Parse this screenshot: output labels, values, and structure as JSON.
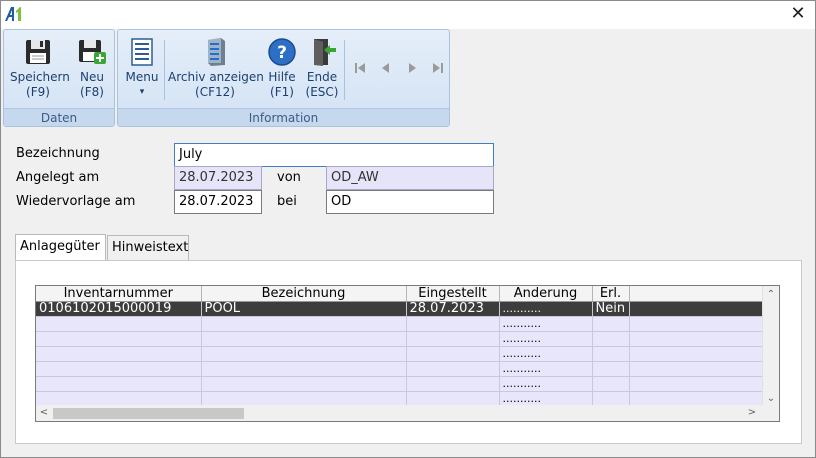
{
  "window": {
    "logo_text": "A1",
    "close_glyph": "✕"
  },
  "ribbon": {
    "groups": [
      {
        "title": "Daten"
      },
      {
        "title": "Information"
      }
    ],
    "buttons": {
      "save": {
        "label1": "Speichern",
        "label2": "(F9)",
        "icon": "floppy-disk-icon"
      },
      "new": {
        "label1": "Neu",
        "label2": "(F8)",
        "icon": "floppy-disk-plus-icon"
      },
      "menu": {
        "label1": "Menu",
        "label2": "▾",
        "icon": "menu-list-icon"
      },
      "archive": {
        "label1": "Archiv anzeigen",
        "label2": "(CF12)",
        "icon": "archive-server-icon"
      },
      "help": {
        "label1": "Hilfe",
        "label2": "(F1)",
        "icon": "help-question-icon"
      },
      "exit": {
        "label1": "Ende",
        "label2": "(ESC)",
        "icon": "exit-door-icon"
      }
    },
    "nav": {
      "first": "first-record-icon",
      "prev": "previous-record-icon",
      "next": "next-record-icon",
      "last": "last-record-icon"
    }
  },
  "form": {
    "bezeichnung_label": "Bezeichnung",
    "bezeichnung_value": "July",
    "angelegt_label": "Angelegt am",
    "angelegt_value": "28.07.2023",
    "von_label": "von",
    "von_value": "OD_AW",
    "wiedervorlage_label": "Wiedervorlage am",
    "wiedervorlage_value": "28.07.2023",
    "bei_label": "bei",
    "bei_value": "OD"
  },
  "tabs": [
    {
      "label": "Anlagegüter"
    },
    {
      "label": "Hinweistext"
    }
  ],
  "grid": {
    "columns": [
      "Inventarnummer",
      "Bezeichnung",
      "Eingestellt",
      "Änderung",
      "Erl.",
      ""
    ],
    "rows": [
      [
        "0106102015000019",
        "POOL",
        "28.07.2023",
        "...........",
        "Nein",
        ""
      ],
      [
        "",
        "",
        "",
        "...........",
        "",
        ""
      ],
      [
        "",
        "",
        "",
        "...........",
        "",
        ""
      ],
      [
        "",
        "",
        "",
        "...........",
        "",
        ""
      ],
      [
        "",
        "",
        "",
        "...........",
        "",
        ""
      ],
      [
        "",
        "",
        "",
        "...........",
        "",
        ""
      ],
      [
        "",
        "",
        "",
        "...........",
        "",
        ""
      ]
    ]
  }
}
